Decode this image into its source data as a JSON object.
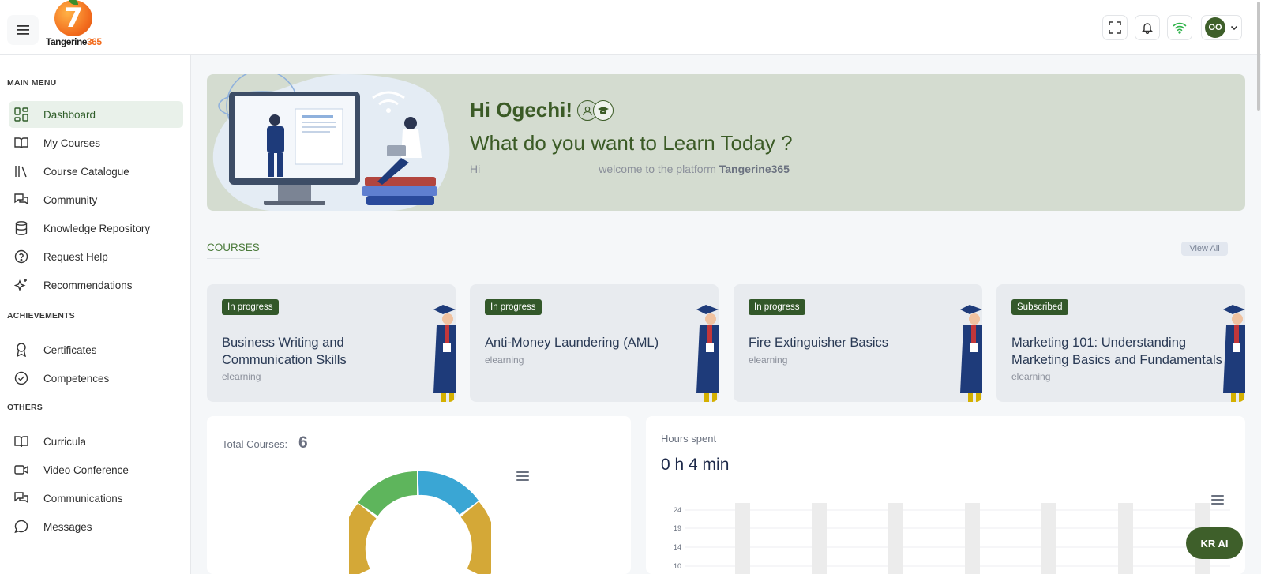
{
  "brand": {
    "name_main": "Tangerine",
    "name_accent": "365",
    "logo_glyph": "7"
  },
  "topbar": {
    "menu_icon": "hamburger-icon",
    "fullscreen_icon": "fullscreen-icon",
    "bell_icon": "bell-icon",
    "wifi_icon": "wifi-icon",
    "avatar_initials": "OO",
    "avatar_color": "#3e5f2a"
  },
  "sidebar": {
    "main_menu_title": "MAIN MENU",
    "main_items": [
      {
        "label": "Dashboard",
        "icon": "dashboard-icon",
        "active": true
      },
      {
        "label": "My Courses",
        "icon": "book-open-icon"
      },
      {
        "label": "Course Catalogue",
        "icon": "library-icon"
      },
      {
        "label": "Community",
        "icon": "chat-bubbles-icon"
      },
      {
        "label": "Knowledge Repository",
        "icon": "database-icon"
      },
      {
        "label": "Request Help",
        "icon": "help-circle-icon"
      },
      {
        "label": "Recommendations",
        "icon": "sparkles-icon"
      }
    ],
    "achievements_title": "ACHIEVEMENTS",
    "achievement_items": [
      {
        "label": "Certificates",
        "icon": "award-icon"
      },
      {
        "label": "Competences",
        "icon": "check-circle-icon"
      }
    ],
    "others_title": "OTHERS",
    "other_items": [
      {
        "label": "Curricula",
        "icon": "book-open-icon"
      },
      {
        "label": "Video Conference",
        "icon": "video-icon"
      },
      {
        "label": "Communications",
        "icon": "chat-bubbles-icon"
      },
      {
        "label": "Messages",
        "icon": "message-circle-icon"
      }
    ]
  },
  "hero": {
    "greeting": "Hi Ogechi!",
    "question": "What do you want to Learn Today ?",
    "sub_prefix": "Hi",
    "sub_text": "welcome to the platform",
    "sub_brand": "Tangerine365"
  },
  "courses": {
    "title": "COURSES",
    "view_all": "View All",
    "items": [
      {
        "status": "In progress",
        "title": "Business Writing and Communication Skills",
        "type": "elearning"
      },
      {
        "status": "In progress",
        "title": "Anti-Money Laundering (AML)",
        "type": "elearning"
      },
      {
        "status": "In progress",
        "title": "Fire Extinguisher Basics",
        "type": "elearning"
      },
      {
        "status": "Subscribed",
        "title": "Marketing 101: Understanding Marketing Basics and Fundamentals",
        "type": "elearning"
      }
    ]
  },
  "total_courses": {
    "label": "Total Courses:",
    "value": "6",
    "segment_colors": [
      "#3aa6d4",
      "#d4a837",
      "#5eb55c"
    ]
  },
  "hours": {
    "label": "Hours spent",
    "value": "0 h 4 min",
    "y_ticks": [
      "24",
      "19",
      "14",
      "10"
    ]
  },
  "kr_ai": {
    "label": "KR AI"
  }
}
